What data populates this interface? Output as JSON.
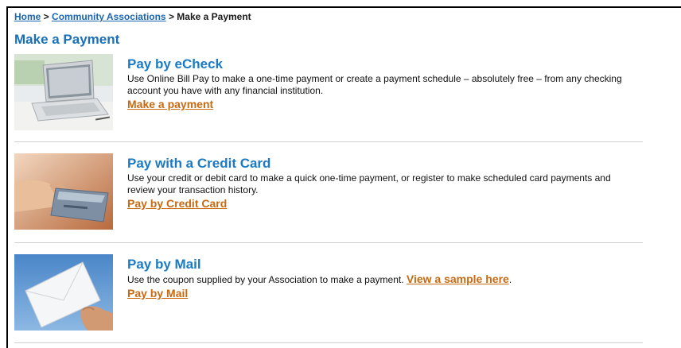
{
  "breadcrumb": {
    "home": "Home",
    "sep1": " > ",
    "community": "Community Associations",
    "sep2": " > ",
    "current": "Make a Payment"
  },
  "page_title": "Make a Payment",
  "options": [
    {
      "title": "Pay by eCheck",
      "description": "Use Online Bill Pay to make a one-time payment or create a payment schedule – absolutely free – from any checking account you have with any financial institution.",
      "action": "Make a payment"
    },
    {
      "title": "Pay with a Credit Card",
      "description": "Use your credit or debit card to make a quick one-time payment, or register to make scheduled card payments and review your transaction history.",
      "action": "Pay by Credit Card"
    },
    {
      "title": "Pay by Mail",
      "description": "Use the coupon supplied by your Association to make a payment. ",
      "inline_link": "View a sample here",
      "description_end": ".",
      "action": "Pay by Mail"
    }
  ],
  "colors": {
    "title_blue": "#1a70b8",
    "link_orange": "#c86a12"
  }
}
